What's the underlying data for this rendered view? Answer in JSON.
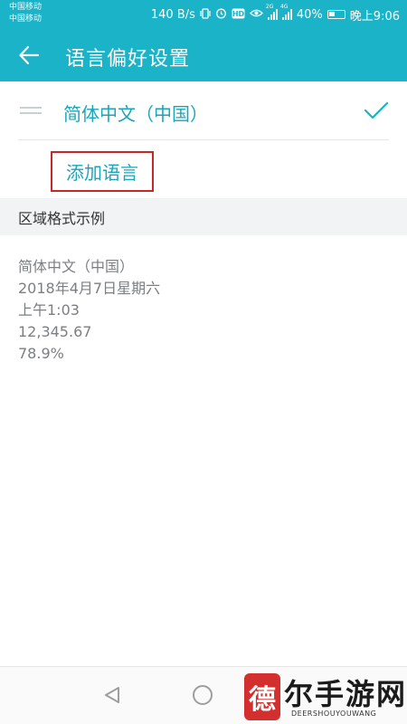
{
  "status_bar": {
    "carriers": [
      "中国移动",
      "中国移动"
    ],
    "net_speed": "140 B/s",
    "network_badge_1": "2G",
    "network_badge_2": "4G",
    "battery": "40%",
    "time": "晚上9:06",
    "icons": [
      "vibrate-icon",
      "alarm-icon",
      "hd-icon",
      "eye-icon",
      "signal-icon",
      "signal-icon",
      "battery-icon"
    ]
  },
  "app_bar": {
    "title": "语言偏好设置",
    "back_icon": "arrow-left-icon"
  },
  "languages": [
    {
      "name": "简体中文（中国）",
      "selected": true
    }
  ],
  "add_language_label": "添加语言",
  "region_section": {
    "header": "区域格式示例",
    "examples": [
      "简体中文（中国）",
      "2018年4月7日星期六",
      "上午1:03",
      "12,345.67",
      "78.9%"
    ]
  },
  "nav_bar": {
    "back_icon": "triangle-back-icon",
    "home_icon": "circle-home-icon"
  },
  "watermark": {
    "logo_char": "德",
    "text": "尔手游网",
    "sub": "DEERSHOUYOUWANG"
  },
  "colors": {
    "accent": "#1ab3c8",
    "link": "#1aa5bb",
    "highlight_border": "#c62828",
    "section_bg": "#f1f3f4"
  }
}
